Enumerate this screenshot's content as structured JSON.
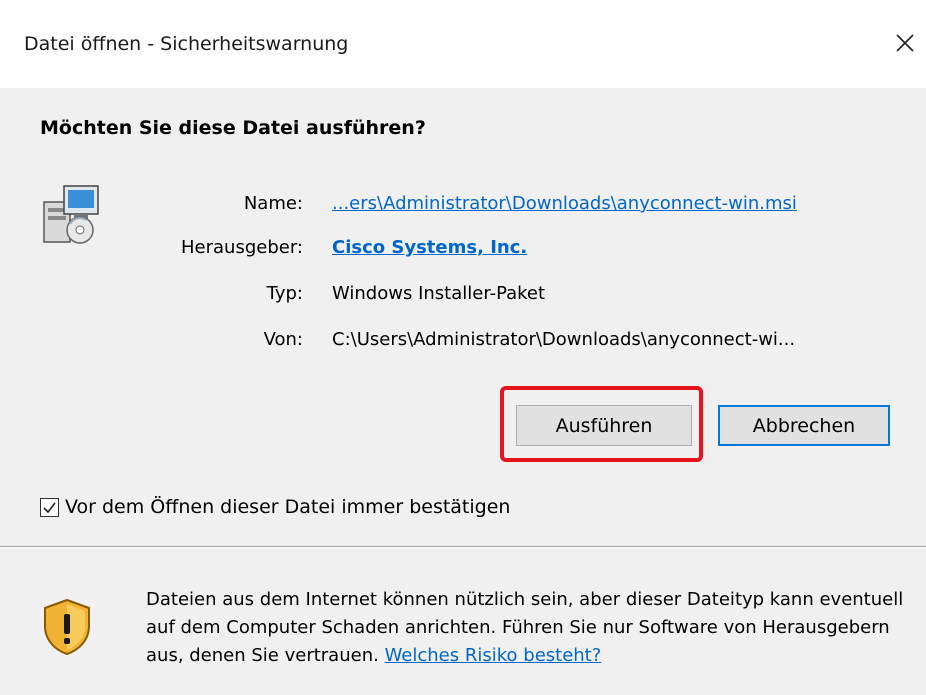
{
  "window": {
    "title": "Datei öffnen - Sicherheitswarnung",
    "close_glyph": "✕"
  },
  "heading": "Möchten Sie diese Datei ausführen?",
  "file_info": {
    "icon": "windows-installer-package-icon",
    "name_label": "Name:",
    "name_value": "...ers\\Administrator\\Downloads\\anyconnect-win.msi",
    "publisher_label": "Herausgeber:",
    "publisher_value": "Cisco Systems, Inc.",
    "type_label": "Typ:",
    "type_value": "Windows Installer-Paket",
    "from_label": "Von:",
    "from_value": "C:\\Users\\Administrator\\Downloads\\anyconnect-wi..."
  },
  "buttons": {
    "run": "Ausführen",
    "cancel": "Abbrechen"
  },
  "checkbox": {
    "label": "Vor dem Öffnen dieser Datei immer bestätigen",
    "checked": true
  },
  "warning": {
    "icon": "shield-warning-icon",
    "text": "Dateien aus dem Internet können nützlich sein, aber dieser Dateityp kann eventuell auf dem Computer Schaden anrichten. Führen Sie nur Software von Herausgebern aus, denen Sie vertrauen.",
    "link": "Welches Risiko besteht?"
  },
  "colors": {
    "link": "#0066cc",
    "highlight": "#e8141c",
    "default_button_border": "#0078d7"
  }
}
